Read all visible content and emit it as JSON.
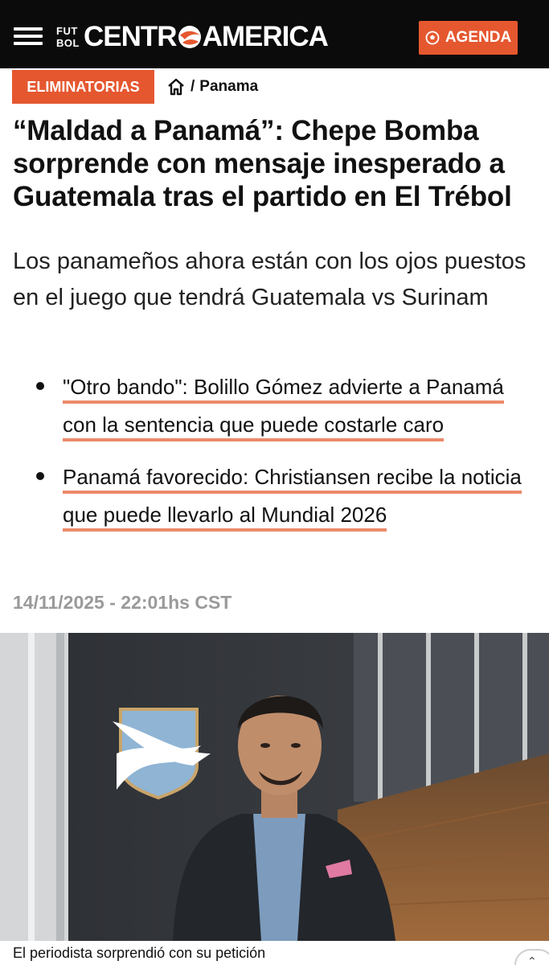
{
  "header": {
    "logo_small_top": "FUT",
    "logo_small_bottom": "BOL",
    "logo_left": "CENTR",
    "logo_right": "AMERICA",
    "agenda_label": "AGENDA",
    "bg_color": "#0b0b0b",
    "accent_color": "#e5572f"
  },
  "breadcrumb": {
    "tag_label": "ELIMINATORIAS",
    "separator": "/",
    "item": "Panama"
  },
  "article": {
    "headline": "“Maldad a Panamá”: Chepe Bomba sorprende con mensaje inesperado a Guatemala tras el partido en El Trébol",
    "subtitle": "Los panameños ahora están con los ojos puestos en el juego que tendrá Guatemala vs Surinam",
    "related": [
      {
        "text": "\"Otro bando\": Bolillo Gómez advierte a Panamá con la sentencia que puede costarle caro"
      },
      {
        "text": "Panamá favorecido: Christiansen recibe la noticia que puede llevarlo al Mundial 2026"
      }
    ],
    "date": "14/11/2025 - 22:01hs CST",
    "image_caption": "El periodista sorprendió con su petición"
  }
}
